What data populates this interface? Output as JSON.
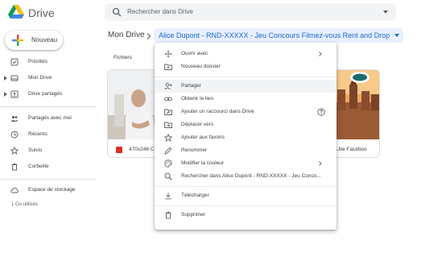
{
  "app": {
    "name": "Drive"
  },
  "search": {
    "placeholder": "Rechercher dans Drive"
  },
  "sidebar": {
    "new_label": "Nouveau",
    "items": [
      {
        "label": "Priorités",
        "icon": "priority-icon"
      },
      {
        "label": "Mon Drive",
        "icon": "my-drive-icon"
      },
      {
        "label": "Drive partagés",
        "icon": "shared-drives-icon"
      },
      {
        "label": "Partagés avec moi",
        "icon": "shared-with-me-icon"
      },
      {
        "label": "Récents",
        "icon": "clock-icon"
      },
      {
        "label": "Suivis",
        "icon": "star-icon"
      },
      {
        "label": "Corbeille",
        "icon": "trash-icon"
      },
      {
        "label": "Espace de stockage",
        "icon": "cloud-icon"
      }
    ],
    "storage_used": "1 Go utilisés"
  },
  "breadcrumb": {
    "root": "Mon Drive",
    "current": "Alice Dupont - RND-XXXXX - Jeu Concours Filmez-vous Rent and Drop"
  },
  "main": {
    "section_label": "Fichiers",
    "files": [
      {
        "name": "470x246 C"
      },
      {
        "name": "Lille Faceboo"
      }
    ]
  },
  "context_menu": {
    "items": [
      {
        "label": "Ouvrir avec",
        "icon": "open-with-icon",
        "submenu": true
      },
      {
        "label": "Nouveau dossier",
        "icon": "new-folder-icon"
      },
      {
        "label": "Partager",
        "icon": "share-icon"
      },
      {
        "label": "Obtenir le lien",
        "icon": "link-icon"
      },
      {
        "label": "Ajouter un raccourci dans Drive",
        "icon": "add-shortcut-icon"
      },
      {
        "label": "Déplacer vers",
        "icon": "move-to-icon"
      },
      {
        "label": "Ajouter aux favoris",
        "icon": "star-outline-icon"
      },
      {
        "label": "Renommer",
        "icon": "rename-icon"
      },
      {
        "label": "Modifier la couleur",
        "icon": "palette-icon",
        "submenu": true
      },
      {
        "label": "Rechercher dans Alice Dupont - RND-XXXXX - Jeu Conco...",
        "icon": "search-in-folder-icon"
      },
      {
        "label": "Télécharger",
        "icon": "download-icon"
      },
      {
        "label": "Supprimer",
        "icon": "delete-icon"
      }
    ]
  },
  "colors": {
    "accent": "#1967d2",
    "breadcrumb_bg": "#e8f0fe",
    "menu_hover": "#f1f3f4"
  }
}
